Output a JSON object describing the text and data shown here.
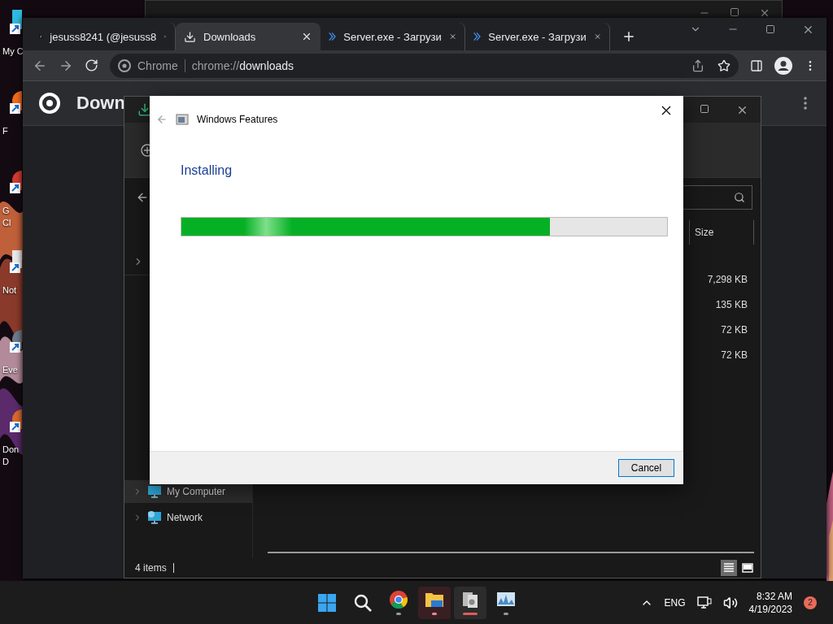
{
  "desktop_icons": [
    {
      "kind": "folder",
      "lines": [
        "My C"
      ]
    },
    {
      "kind": "fox",
      "lines": [
        "F"
      ]
    },
    {
      "kind": "globe",
      "lines": [
        "G",
        "Cl"
      ]
    },
    {
      "kind": "notepad",
      "lines": [
        "Not"
      ]
    },
    {
      "kind": "viewer",
      "lines": [
        "Eve"
      ]
    },
    {
      "kind": "mule",
      "lines": [
        "Don",
        "D"
      ]
    }
  ],
  "browser": {
    "tabs": [
      {
        "kind": "tiktok",
        "title": "jesuss8241 (@jesuss8",
        "selected": false
      },
      {
        "kind": "download",
        "title": "Downloads",
        "selected": true
      },
      {
        "kind": "server",
        "title": "Server.exe - Загрузи",
        "selected": false
      },
      {
        "kind": "server",
        "title": "Server.exe - Загрузи",
        "selected": false
      }
    ],
    "address": {
      "site": "Chrome",
      "scheme": "chrome://",
      "host": "downloads"
    },
    "page_title": "Down"
  },
  "explorer": {
    "columns": [
      {
        "label": "Size"
      }
    ],
    "sizes": [
      "7,298 KB",
      "135 KB",
      "72 KB",
      "72 KB"
    ],
    "nav": [
      {
        "kind": "computer",
        "label": "My Computer",
        "selected": true
      },
      {
        "kind": "network",
        "label": "Network",
        "selected": false
      }
    ],
    "status": "4 items",
    "views": [
      {
        "kind": "details",
        "selected": true
      },
      {
        "kind": "preview",
        "selected": false
      }
    ]
  },
  "dialog": {
    "title": "Windows Features",
    "heading": "Installing",
    "progress": {
      "level": 0.758
    },
    "buttons": [
      "Cancel"
    ]
  },
  "taskbar": {
    "apps": [
      {
        "kind": "start",
        "running": false,
        "selected": false,
        "flagged": false
      },
      {
        "kind": "search",
        "running": false,
        "selected": false,
        "flagged": false
      },
      {
        "kind": "chrome",
        "running": true,
        "selected": false,
        "flagged": false
      },
      {
        "kind": "files",
        "running": true,
        "selected": false,
        "flagged": true
      },
      {
        "kind": "installer",
        "running": true,
        "selected": true,
        "flagged": false
      },
      {
        "kind": "monitor",
        "running": true,
        "selected": false,
        "flagged": false
      }
    ],
    "language": "ENG",
    "time": "8:32 AM",
    "date": "4/19/2023",
    "notifications": "2"
  }
}
